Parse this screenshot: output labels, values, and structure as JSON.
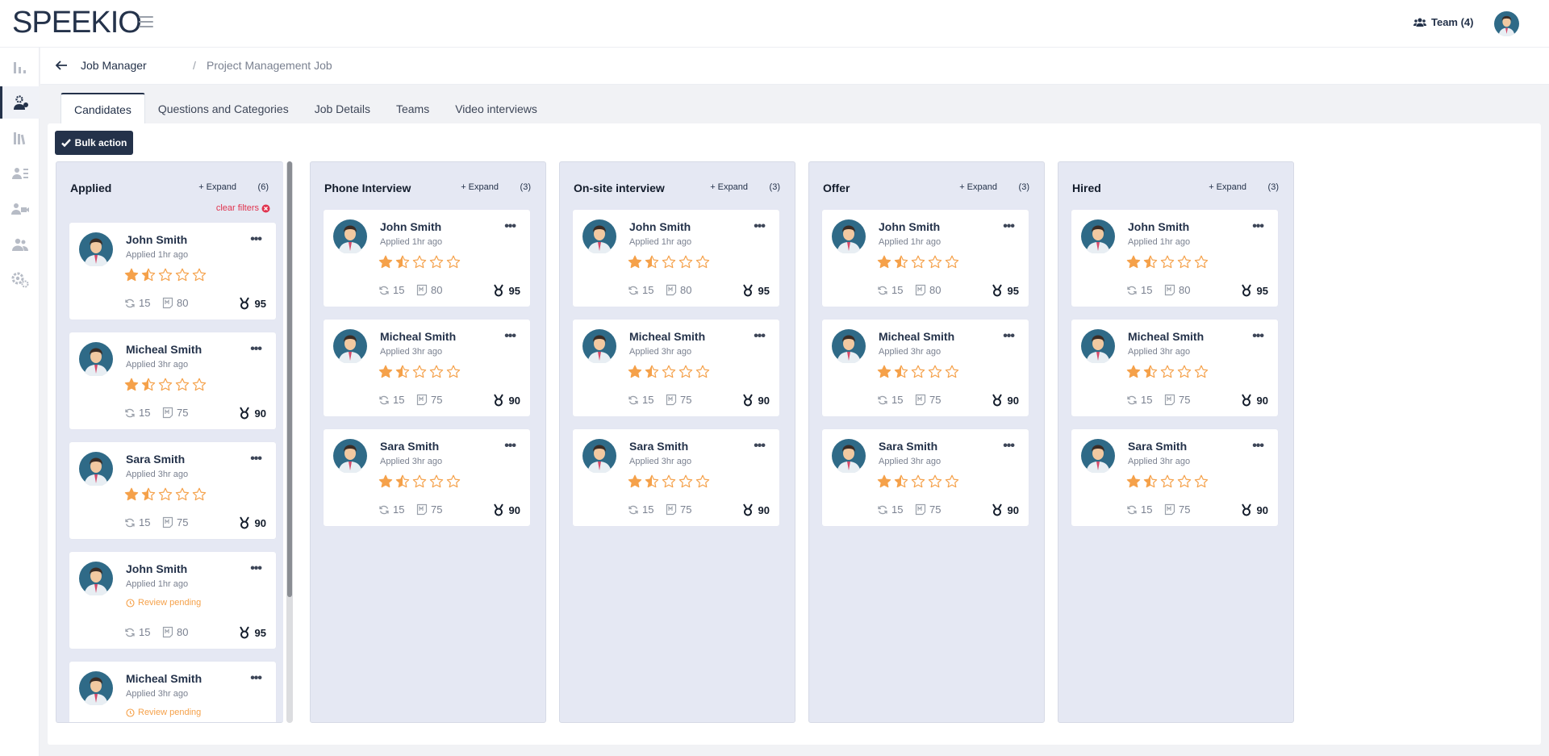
{
  "app": {
    "logo": "SPEEKIO",
    "team_label": "Team (4)"
  },
  "breadcrumb": {
    "parent": "Job Manager",
    "separator": "/",
    "current": "Project Management Job"
  },
  "tabs": [
    "Candidates",
    "Questions and Categories",
    "Job Details",
    "Teams",
    "Video interviews"
  ],
  "bulk_action_label": "Bulk action",
  "clear_filters_label": "clear filters",
  "expand_label": "+ Expand",
  "colors": {
    "primary": "#24324a",
    "star": "#f5a14a",
    "column_bg": "#e5e8f3",
    "danger": "#e0344f"
  },
  "columns": [
    {
      "title": "Applied",
      "count": "(6)",
      "cards": [
        {
          "name": "John Smith",
          "applied": "Applied 1hr ago",
          "rating": 1.5,
          "m1": "15",
          "m2": "80",
          "score": "95"
        },
        {
          "name": "Micheal Smith",
          "applied": "Applied 3hr ago",
          "rating": 1.5,
          "m1": "15",
          "m2": "75",
          "score": "90"
        },
        {
          "name": "Sara Smith",
          "applied": "Applied 3hr ago",
          "rating": 1.5,
          "m1": "15",
          "m2": "75",
          "score": "90"
        },
        {
          "name": "John Smith",
          "applied": "Applied 1hr ago",
          "review": "Review pending",
          "m1": "15",
          "m2": "80",
          "score": "95"
        },
        {
          "name": "Micheal Smith",
          "applied": "Applied 3hr ago",
          "review": "Review pending"
        }
      ]
    },
    {
      "title": "Phone Interview",
      "count": "(3)",
      "cards": [
        {
          "name": "John Smith",
          "applied": "Applied 1hr ago",
          "rating": 1.5,
          "m1": "15",
          "m2": "80",
          "score": "95"
        },
        {
          "name": "Micheal Smith",
          "applied": "Applied 3hr ago",
          "rating": 1.5,
          "m1": "15",
          "m2": "75",
          "score": "90"
        },
        {
          "name": "Sara Smith",
          "applied": "Applied 3hr ago",
          "rating": 1.5,
          "m1": "15",
          "m2": "75",
          "score": "90"
        }
      ]
    },
    {
      "title": "On-site interview",
      "count": "(3)",
      "cards": [
        {
          "name": "John Smith",
          "applied": "Applied 1hr ago",
          "rating": 1.5,
          "m1": "15",
          "m2": "80",
          "score": "95"
        },
        {
          "name": "Micheal Smith",
          "applied": "Applied 3hr ago",
          "rating": 1.5,
          "m1": "15",
          "m2": "75",
          "score": "90"
        },
        {
          "name": "Sara Smith",
          "applied": "Applied 3hr ago",
          "rating": 1.5,
          "m1": "15",
          "m2": "75",
          "score": "90"
        }
      ]
    },
    {
      "title": "Offer",
      "count": "(3)",
      "cards": [
        {
          "name": "John Smith",
          "applied": "Applied 1hr ago",
          "rating": 1.5,
          "m1": "15",
          "m2": "80",
          "score": "95"
        },
        {
          "name": "Micheal Smith",
          "applied": "Applied 3hr ago",
          "rating": 1.5,
          "m1": "15",
          "m2": "75",
          "score": "90"
        },
        {
          "name": "Sara Smith",
          "applied": "Applied 3hr ago",
          "rating": 1.5,
          "m1": "15",
          "m2": "75",
          "score": "90"
        }
      ]
    },
    {
      "title": "Hired",
      "count": "(3)",
      "cards": [
        {
          "name": "John Smith",
          "applied": "Applied 1hr ago",
          "rating": 1.5,
          "m1": "15",
          "m2": "80",
          "score": "95"
        },
        {
          "name": "Micheal Smith",
          "applied": "Applied 3hr ago",
          "rating": 1.5,
          "m1": "15",
          "m2": "75",
          "score": "90"
        },
        {
          "name": "Sara Smith",
          "applied": "Applied 3hr ago",
          "rating": 1.5,
          "m1": "15",
          "m2": "75",
          "score": "90"
        }
      ]
    }
  ],
  "sidebar_icons": [
    "chart-icon",
    "job-manager-icon",
    "library-icon",
    "candidates-icon",
    "video-icon",
    "users-icon",
    "settings-icon"
  ]
}
